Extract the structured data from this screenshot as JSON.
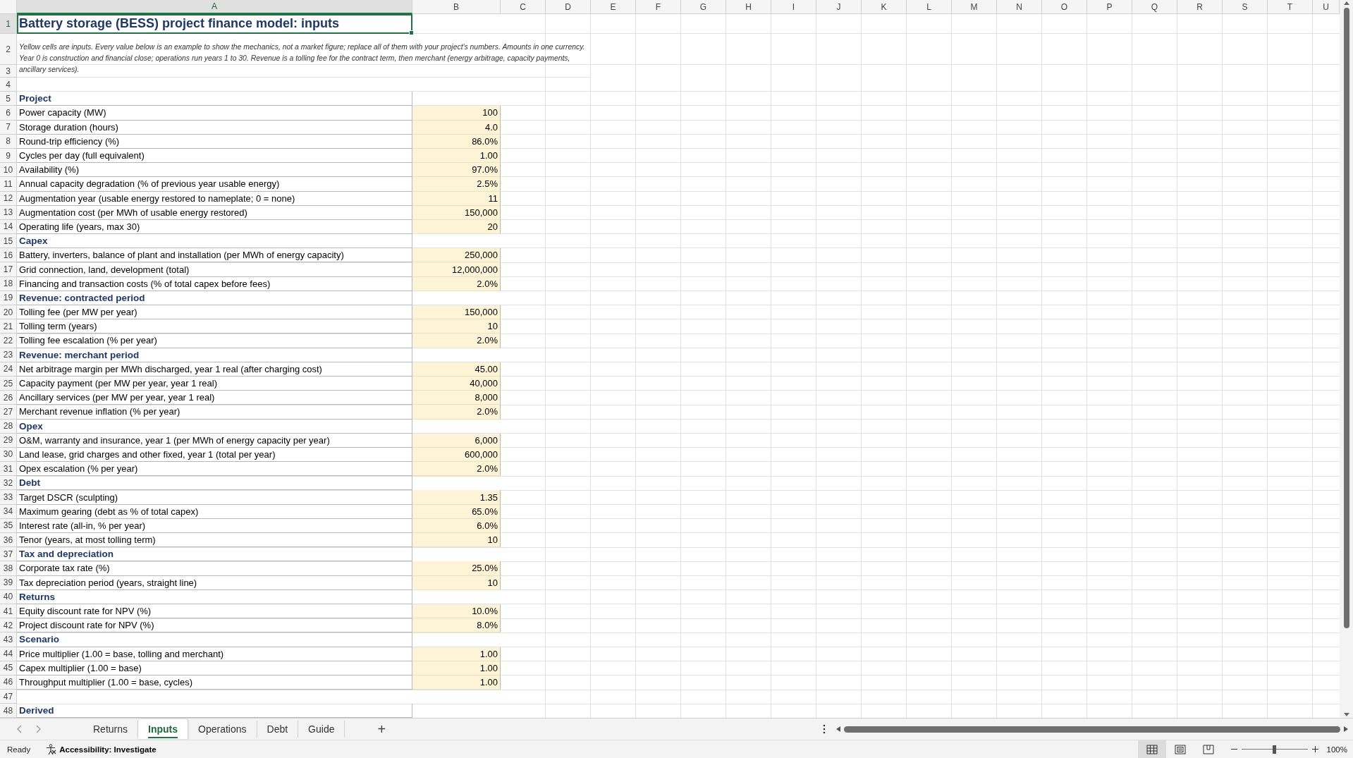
{
  "sheet": {
    "columns": [
      {
        "label": "A",
        "selected": true
      },
      {
        "label": "B",
        "selected": false
      },
      {
        "label": "C",
        "selected": false
      },
      {
        "label": "D",
        "selected": false
      },
      {
        "label": "E",
        "selected": false
      },
      {
        "label": "F",
        "selected": false
      },
      {
        "label": "G",
        "selected": false
      },
      {
        "label": "H",
        "selected": false
      },
      {
        "label": "I",
        "selected": false
      },
      {
        "label": "J",
        "selected": false
      },
      {
        "label": "K",
        "selected": false
      },
      {
        "label": "L",
        "selected": false
      },
      {
        "label": "M",
        "selected": false
      },
      {
        "label": "N",
        "selected": false
      },
      {
        "label": "O",
        "selected": false
      },
      {
        "label": "P",
        "selected": false
      },
      {
        "label": "Q",
        "selected": false
      },
      {
        "label": "R",
        "selected": false
      },
      {
        "label": "S",
        "selected": false
      },
      {
        "label": "T",
        "selected": false
      },
      {
        "label": "U",
        "selected": false
      }
    ],
    "rows": [
      {
        "number": "1",
        "kind": "title",
        "text": "Battery storage (BESS) project finance model: inputs",
        "selected": true
      },
      {
        "number": "2",
        "kind": "note",
        "text": "Yellow cells are inputs. Every value below is an example to show the mechanics, not a market figure; replace all of them with your project's numbers. Amounts in one currency. Year 0 is construction and financial close; operations run years 1 to 30. Revenue is a tolling fee for the contract term, then merchant (energy arbitrage, capacity payments, ancillary services).",
        "selected": false
      },
      {
        "number": "3",
        "kind": "continued",
        "selected": false
      },
      {
        "number": "4",
        "kind": "blank",
        "selected": false
      },
      {
        "number": "5",
        "kind": "section",
        "text": "Project",
        "selected": false
      },
      {
        "number": "6",
        "kind": "input",
        "text": "Power capacity (MW)",
        "value": "100",
        "selected": false
      },
      {
        "number": "7",
        "kind": "input",
        "text": "Storage duration (hours)",
        "value": "4.0",
        "selected": false
      },
      {
        "number": "8",
        "kind": "input",
        "text": "Round-trip efficiency (%)",
        "value": "86.0%",
        "selected": false
      },
      {
        "number": "9",
        "kind": "input",
        "text": "Cycles per day (full equivalent)",
        "value": "1.00",
        "selected": false
      },
      {
        "number": "10",
        "kind": "input",
        "text": "Availability (%)",
        "value": "97.0%",
        "selected": false
      },
      {
        "number": "11",
        "kind": "input",
        "text": "Annual capacity degradation (% of previous year usable energy)",
        "value": "2.5%",
        "selected": false
      },
      {
        "number": "12",
        "kind": "input",
        "text": "Augmentation year (usable energy restored to nameplate; 0 = none)",
        "value": "11",
        "selected": false
      },
      {
        "number": "13",
        "kind": "input",
        "text": "Augmentation cost (per MWh of usable energy restored)",
        "value": "150,000",
        "selected": false
      },
      {
        "number": "14",
        "kind": "input",
        "text": "Operating life (years, max 30)",
        "value": "20",
        "selected": false
      },
      {
        "number": "15",
        "kind": "section",
        "text": "Capex",
        "selected": false
      },
      {
        "number": "16",
        "kind": "input",
        "text": "Battery, inverters, balance of plant and installation (per MWh of energy capacity)",
        "value": "250,000",
        "selected": false
      },
      {
        "number": "17",
        "kind": "input",
        "text": "Grid connection, land, development (total)",
        "value": "12,000,000",
        "selected": false
      },
      {
        "number": "18",
        "kind": "input",
        "text": "Financing and transaction costs (% of total capex before fees)",
        "value": "2.0%",
        "selected": false
      },
      {
        "number": "19",
        "kind": "section",
        "text": "Revenue: contracted period",
        "selected": false
      },
      {
        "number": "20",
        "kind": "input",
        "text": "Tolling fee (per MW per year)",
        "value": "150,000",
        "selected": false
      },
      {
        "number": "21",
        "kind": "input",
        "text": "Tolling term (years)",
        "value": "10",
        "selected": false
      },
      {
        "number": "22",
        "kind": "input",
        "text": "Tolling fee escalation (% per year)",
        "value": "2.0%",
        "selected": false
      },
      {
        "number": "23",
        "kind": "section",
        "text": "Revenue: merchant period",
        "selected": false
      },
      {
        "number": "24",
        "kind": "input",
        "text": "Net arbitrage margin per MWh discharged, year 1 real (after charging cost)",
        "value": "45.00",
        "selected": false
      },
      {
        "number": "25",
        "kind": "input",
        "text": "Capacity payment (per MW per year, year 1 real)",
        "value": "40,000",
        "selected": false
      },
      {
        "number": "26",
        "kind": "input",
        "text": "Ancillary services (per MW per year, year 1 real)",
        "value": "8,000",
        "selected": false
      },
      {
        "number": "27",
        "kind": "input",
        "text": "Merchant revenue inflation (% per year)",
        "value": "2.0%",
        "selected": false
      },
      {
        "number": "28",
        "kind": "section",
        "text": "Opex",
        "selected": false
      },
      {
        "number": "29",
        "kind": "input",
        "text": "O&M, warranty and insurance, year 1 (per MWh of energy capacity per year)",
        "value": "6,000",
        "selected": false
      },
      {
        "number": "30",
        "kind": "input",
        "text": "Land lease, grid charges and other fixed, year 1 (total per year)",
        "value": "600,000",
        "selected": false
      },
      {
        "number": "31",
        "kind": "input",
        "text": "Opex escalation (% per year)",
        "value": "2.0%",
        "selected": false
      },
      {
        "number": "32",
        "kind": "section",
        "text": "Debt",
        "selected": false
      },
      {
        "number": "33",
        "kind": "input",
        "text": "Target DSCR (sculpting)",
        "value": "1.35",
        "selected": false
      },
      {
        "number": "34",
        "kind": "input",
        "text": "Maximum gearing (debt as % of total capex)",
        "value": "65.0%",
        "selected": false
      },
      {
        "number": "35",
        "kind": "input",
        "text": "Interest rate (all-in, % per year)",
        "value": "6.0%",
        "selected": false
      },
      {
        "number": "36",
        "kind": "input",
        "text": "Tenor (years, at most tolling term)",
        "value": "10",
        "selected": false
      },
      {
        "number": "37",
        "kind": "section",
        "text": "Tax and depreciation",
        "selected": false
      },
      {
        "number": "38",
        "kind": "input",
        "text": "Corporate tax rate (%)",
        "value": "25.0%",
        "selected": false
      },
      {
        "number": "39",
        "kind": "input",
        "text": "Tax depreciation period (years, straight line)",
        "value": "10",
        "selected": false
      },
      {
        "number": "40",
        "kind": "section",
        "text": "Returns",
        "selected": false
      },
      {
        "number": "41",
        "kind": "input",
        "text": "Equity discount rate for NPV (%)",
        "value": "10.0%",
        "selected": false
      },
      {
        "number": "42",
        "kind": "input",
        "text": "Project discount rate for NPV (%)",
        "value": "8.0%",
        "selected": false
      },
      {
        "number": "43",
        "kind": "section",
        "text": "Scenario",
        "selected": false
      },
      {
        "number": "44",
        "kind": "input",
        "text": "Price multiplier (1.00 = base, tolling and merchant)",
        "value": "1.00",
        "selected": false
      },
      {
        "number": "45",
        "kind": "input",
        "text": "Capex multiplier (1.00 = base)",
        "value": "1.00",
        "selected": false
      },
      {
        "number": "46",
        "kind": "input",
        "text": "Throughput multiplier (1.00 = base, cycles)",
        "value": "1.00",
        "selected": false
      },
      {
        "number": "47",
        "kind": "blank",
        "selected": false
      },
      {
        "number": "48",
        "kind": "section",
        "text": "Derived",
        "selected": false
      }
    ]
  },
  "sheet_tabs": [
    {
      "label": "Returns",
      "selected": false
    },
    {
      "label": "Inputs",
      "selected": true
    },
    {
      "label": "Operations",
      "selected": false
    },
    {
      "label": "Debt",
      "selected": false
    },
    {
      "label": "Guide",
      "selected": false
    }
  ],
  "add_sheet": "+",
  "status_bar": {
    "mode": "Ready",
    "accessibility": "Accessibility: Investigate",
    "views": [
      {
        "kind": "normal",
        "selected": true
      },
      {
        "kind": "page-layout",
        "selected": false
      },
      {
        "kind": "page-break",
        "selected": false
      }
    ],
    "zoom": {
      "level": 0.5,
      "reading": "100%"
    }
  }
}
